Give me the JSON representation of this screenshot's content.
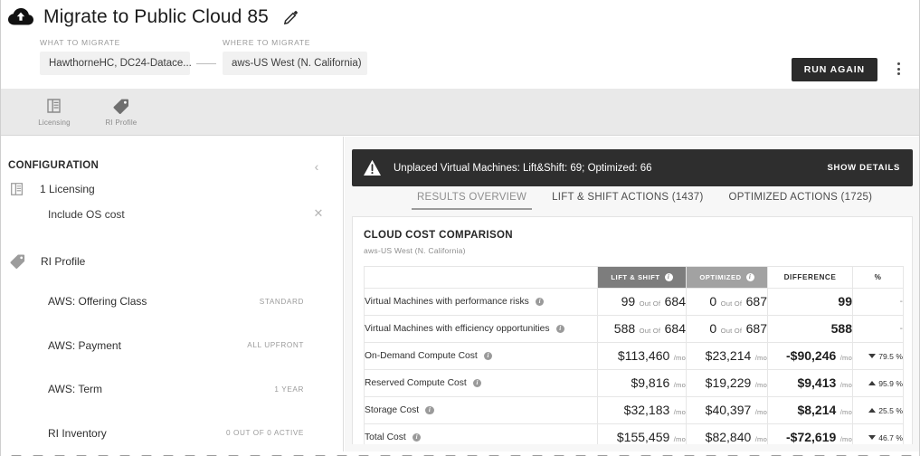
{
  "header": {
    "cloud_icon": "cloud-upload-icon",
    "title": "Migrate to Public Cloud 85",
    "edit_icon": "pencil-icon",
    "what_to_migrate": {
      "label": "WHAT TO MIGRATE",
      "value": "HawthorneHC, DC24-Datace..."
    },
    "separator_icon": "arrow-right-icon",
    "where_to_migrate": {
      "label": "WHERE TO MIGRATE",
      "value": "aws-US West (N. California)"
    },
    "run_again_label": "RUN AGAIN",
    "more_icon": "kebab-menu-icon"
  },
  "tool_tabs": [
    {
      "label": "Licensing",
      "icon": "document-lines-icon"
    },
    {
      "label": "RI Profile",
      "icon": "tag-icon"
    }
  ],
  "sidebar": {
    "heading": "CONFIGURATION",
    "collapse_icon": "chevron-left-icon",
    "licensing": {
      "icon": "document-lines-icon",
      "label": "1 Licensing",
      "sub_item": "Include OS cost",
      "remove_icon": "close-icon"
    },
    "ri_profile": {
      "icon": "tag-icon",
      "label": "RI Profile",
      "items": [
        {
          "name": "AWS: Offering Class",
          "value": "STANDARD"
        },
        {
          "name": "AWS: Payment",
          "value": "ALL UPFRONT"
        },
        {
          "name": "AWS: Term",
          "value": "1 YEAR"
        },
        {
          "name": "RI Inventory",
          "value": "0 OUT OF 0 ACTIVE"
        }
      ]
    }
  },
  "alert": {
    "icon": "warning-triangle-icon",
    "message": "Unplaced Virtual Machines: Lift&Shift: 69; Optimized: 66",
    "action_label": "SHOW DETAILS"
  },
  "result_tabs": [
    {
      "label": "RESULTS OVERVIEW",
      "active": true
    },
    {
      "label": "LIFT & SHIFT ACTIONS (1437)",
      "active": false
    },
    {
      "label": "OPTIMIZED ACTIONS (1725)",
      "active": false
    }
  ],
  "card": {
    "title": "CLOUD COST COMPARISON",
    "subtitle": "aws-US West (N. California)",
    "info_glyph": "i",
    "columns": [
      {
        "label": "",
        "key": "name",
        "bg": "#ffffff"
      },
      {
        "label": "LIFT & SHIFT",
        "key": "lift_shift",
        "bg": "#7d7d7d",
        "has_info": true
      },
      {
        "label": "OPTIMIZED",
        "key": "optimized",
        "bg": "#a2a2a2",
        "has_info": true
      },
      {
        "label": "DIFFERENCE",
        "key": "difference",
        "bg": "#ffffff",
        "has_info": false
      },
      {
        "label": "%",
        "key": "percent",
        "bg": "#ffffff",
        "has_info": false
      }
    ],
    "out_of_label": "Out Of",
    "per_month_label": "/mo",
    "rows": [
      {
        "name": "Virtual Machines with performance risks",
        "ls_value": "99",
        "ls_suffix": "Out Of",
        "ls_total": "684",
        "opt_value": "0",
        "opt_suffix": "Out Of",
        "opt_total": "687",
        "diff_value": "99",
        "diff_suffix": "",
        "pct": "-",
        "trend": "none"
      },
      {
        "name": "Virtual Machines with efficiency opportunities",
        "ls_value": "588",
        "ls_suffix": "Out Of",
        "ls_total": "684",
        "opt_value": "0",
        "opt_suffix": "Out Of",
        "opt_total": "687",
        "diff_value": "588",
        "diff_suffix": "",
        "pct": "-",
        "trend": "none"
      },
      {
        "name": "On-Demand Compute Cost",
        "ls_value": "$113,460",
        "ls_suffix": "/mo",
        "ls_total": "",
        "opt_value": "$23,214",
        "opt_suffix": "/mo",
        "opt_total": "",
        "diff_value": "-$90,246",
        "diff_suffix": "/mo",
        "pct": "79.5 %",
        "trend": "down"
      },
      {
        "name": "Reserved Compute Cost",
        "ls_value": "$9,816",
        "ls_suffix": "/mo",
        "ls_total": "",
        "opt_value": "$19,229",
        "opt_suffix": "/mo",
        "opt_total": "",
        "diff_value": "$9,413",
        "diff_suffix": "/mo",
        "pct": "95.9 %",
        "trend": "up"
      },
      {
        "name": "Storage Cost",
        "ls_value": "$32,183",
        "ls_suffix": "/mo",
        "ls_total": "",
        "opt_value": "$40,397",
        "opt_suffix": "/mo",
        "opt_total": "",
        "diff_value": "$8,214",
        "diff_suffix": "/mo",
        "pct": "25.5 %",
        "trend": "up"
      },
      {
        "name": "Total Cost",
        "ls_value": "$155,459",
        "ls_suffix": "/mo",
        "ls_total": "",
        "opt_value": "$82,840",
        "opt_suffix": "/mo",
        "opt_total": "",
        "diff_value": "-$72,619",
        "diff_suffix": "/mo",
        "pct": "46.7 %",
        "trend": "down"
      }
    ]
  },
  "colors": {
    "accent_dark": "#2e2e2e",
    "lift_shift_header": "#7d7d7d",
    "optimized_header": "#a2a2a2",
    "tabstrip_bg": "#e9e9e9",
    "panel_bg": "#f7f7f7"
  }
}
